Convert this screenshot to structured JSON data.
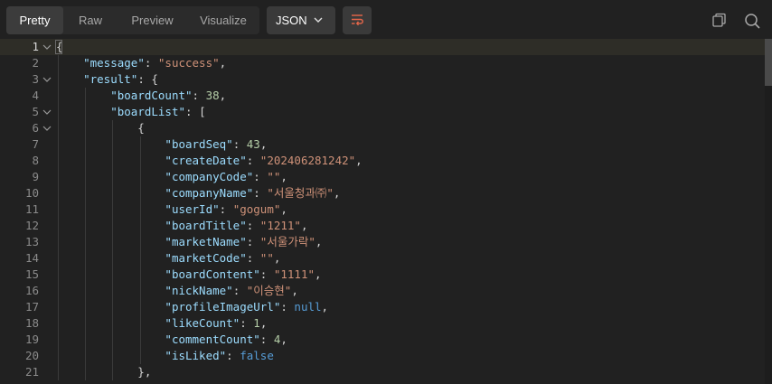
{
  "tabs": [
    "Pretty",
    "Raw",
    "Preview",
    "Visualize"
  ],
  "active_tab": "Pretty",
  "format": "JSON",
  "colors": {
    "key": "#9cdcfe",
    "string": "#ce9178",
    "number": "#b5cea8",
    "literal": "#569cd6",
    "accent": "#e8674a"
  },
  "icons": {
    "format_dropdown": "chevron-down-icon",
    "wrap": "wrap-lines-icon",
    "copy": "copy-icon",
    "search": "search-icon"
  },
  "lines": [
    {
      "n": "1",
      "tokens": [
        {
          "t": "p",
          "v": "{"
        }
      ],
      "fold": true,
      "active": true
    },
    {
      "n": "2",
      "tokens": [
        {
          "t": "p",
          "v": "    "
        },
        {
          "t": "k",
          "v": "\"message\""
        },
        {
          "t": "p",
          "v": ": "
        },
        {
          "t": "s",
          "v": "\"success\""
        },
        {
          "t": "p",
          "v": ","
        }
      ]
    },
    {
      "n": "3",
      "tokens": [
        {
          "t": "p",
          "v": "    "
        },
        {
          "t": "k",
          "v": "\"result\""
        },
        {
          "t": "p",
          "v": ": {"
        }
      ],
      "fold": true
    },
    {
      "n": "4",
      "tokens": [
        {
          "t": "p",
          "v": "        "
        },
        {
          "t": "k",
          "v": "\"boardCount\""
        },
        {
          "t": "p",
          "v": ": "
        },
        {
          "t": "n",
          "v": "38"
        },
        {
          "t": "p",
          "v": ","
        }
      ]
    },
    {
      "n": "5",
      "tokens": [
        {
          "t": "p",
          "v": "        "
        },
        {
          "t": "k",
          "v": "\"boardList\""
        },
        {
          "t": "p",
          "v": ": ["
        }
      ],
      "fold": true
    },
    {
      "n": "6",
      "tokens": [
        {
          "t": "p",
          "v": "            {"
        }
      ],
      "fold": true
    },
    {
      "n": "7",
      "tokens": [
        {
          "t": "p",
          "v": "                "
        },
        {
          "t": "k",
          "v": "\"boardSeq\""
        },
        {
          "t": "p",
          "v": ": "
        },
        {
          "t": "n",
          "v": "43"
        },
        {
          "t": "p",
          "v": ","
        }
      ]
    },
    {
      "n": "8",
      "tokens": [
        {
          "t": "p",
          "v": "                "
        },
        {
          "t": "k",
          "v": "\"createDate\""
        },
        {
          "t": "p",
          "v": ": "
        },
        {
          "t": "s",
          "v": "\"202406281242\""
        },
        {
          "t": "p",
          "v": ","
        }
      ]
    },
    {
      "n": "9",
      "tokens": [
        {
          "t": "p",
          "v": "                "
        },
        {
          "t": "k",
          "v": "\"companyCode\""
        },
        {
          "t": "p",
          "v": ": "
        },
        {
          "t": "s",
          "v": "\"\""
        },
        {
          "t": "p",
          "v": ","
        }
      ]
    },
    {
      "n": "10",
      "tokens": [
        {
          "t": "p",
          "v": "                "
        },
        {
          "t": "k",
          "v": "\"companyName\""
        },
        {
          "t": "p",
          "v": ": "
        },
        {
          "t": "s",
          "v": "\"서울청과㈜\""
        },
        {
          "t": "p",
          "v": ","
        }
      ]
    },
    {
      "n": "11",
      "tokens": [
        {
          "t": "p",
          "v": "                "
        },
        {
          "t": "k",
          "v": "\"userId\""
        },
        {
          "t": "p",
          "v": ": "
        },
        {
          "t": "s",
          "v": "\"gogum\""
        },
        {
          "t": "p",
          "v": ","
        }
      ]
    },
    {
      "n": "12",
      "tokens": [
        {
          "t": "p",
          "v": "                "
        },
        {
          "t": "k",
          "v": "\"boardTitle\""
        },
        {
          "t": "p",
          "v": ": "
        },
        {
          "t": "s",
          "v": "\"1211\""
        },
        {
          "t": "p",
          "v": ","
        }
      ]
    },
    {
      "n": "13",
      "tokens": [
        {
          "t": "p",
          "v": "                "
        },
        {
          "t": "k",
          "v": "\"marketName\""
        },
        {
          "t": "p",
          "v": ": "
        },
        {
          "t": "s",
          "v": "\"서울가락\""
        },
        {
          "t": "p",
          "v": ","
        }
      ]
    },
    {
      "n": "14",
      "tokens": [
        {
          "t": "p",
          "v": "                "
        },
        {
          "t": "k",
          "v": "\"marketCode\""
        },
        {
          "t": "p",
          "v": ": "
        },
        {
          "t": "s",
          "v": "\"\""
        },
        {
          "t": "p",
          "v": ","
        }
      ]
    },
    {
      "n": "15",
      "tokens": [
        {
          "t": "p",
          "v": "                "
        },
        {
          "t": "k",
          "v": "\"boardContent\""
        },
        {
          "t": "p",
          "v": ": "
        },
        {
          "t": "s",
          "v": "\"1111\""
        },
        {
          "t": "p",
          "v": ","
        }
      ]
    },
    {
      "n": "16",
      "tokens": [
        {
          "t": "p",
          "v": "                "
        },
        {
          "t": "k",
          "v": "\"nickName\""
        },
        {
          "t": "p",
          "v": ": "
        },
        {
          "t": "s",
          "v": "\"이승현\""
        },
        {
          "t": "p",
          "v": ","
        }
      ]
    },
    {
      "n": "17",
      "tokens": [
        {
          "t": "p",
          "v": "                "
        },
        {
          "t": "k",
          "v": "\"profileImageUrl\""
        },
        {
          "t": "p",
          "v": ": "
        },
        {
          "t": "b",
          "v": "null"
        },
        {
          "t": "p",
          "v": ","
        }
      ]
    },
    {
      "n": "18",
      "tokens": [
        {
          "t": "p",
          "v": "                "
        },
        {
          "t": "k",
          "v": "\"likeCount\""
        },
        {
          "t": "p",
          "v": ": "
        },
        {
          "t": "n",
          "v": "1"
        },
        {
          "t": "p",
          "v": ","
        }
      ]
    },
    {
      "n": "19",
      "tokens": [
        {
          "t": "p",
          "v": "                "
        },
        {
          "t": "k",
          "v": "\"commentCount\""
        },
        {
          "t": "p",
          "v": ": "
        },
        {
          "t": "n",
          "v": "4"
        },
        {
          "t": "p",
          "v": ","
        }
      ]
    },
    {
      "n": "20",
      "tokens": [
        {
          "t": "p",
          "v": "                "
        },
        {
          "t": "k",
          "v": "\"isLiked\""
        },
        {
          "t": "p",
          "v": ": "
        },
        {
          "t": "b",
          "v": "false"
        }
      ]
    },
    {
      "n": "21",
      "tokens": [
        {
          "t": "p",
          "v": "            },"
        }
      ]
    }
  ]
}
